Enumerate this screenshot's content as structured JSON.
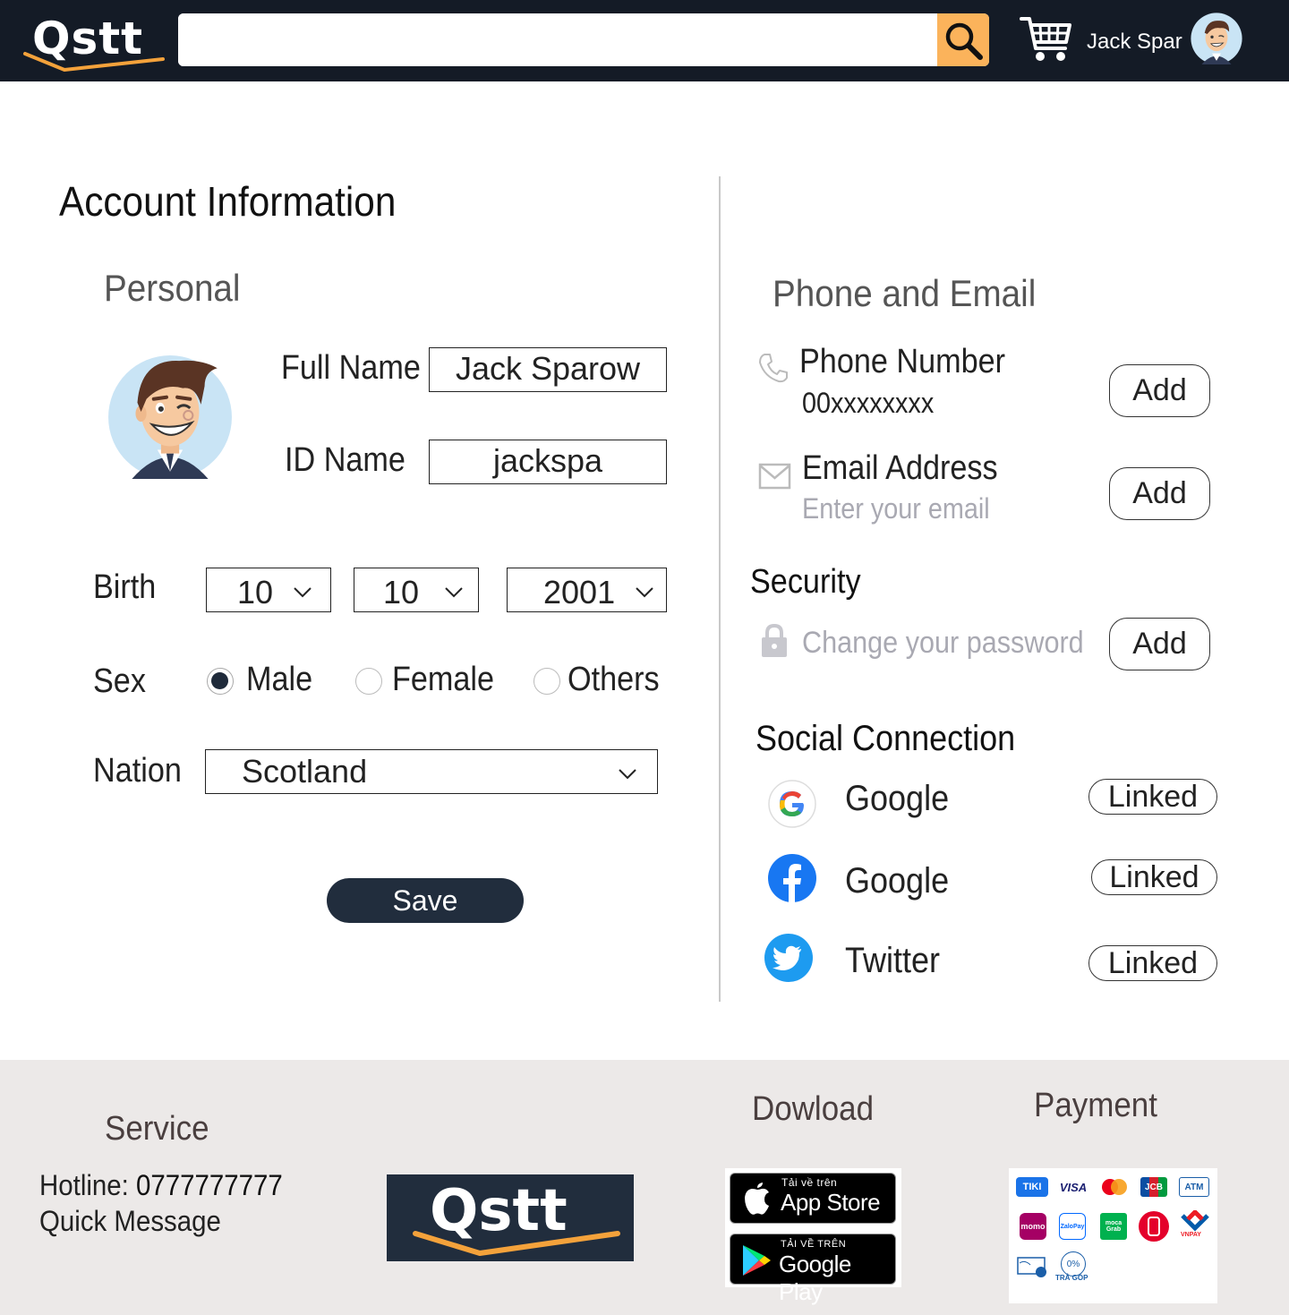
{
  "header": {
    "logo": "Qstt",
    "search_placeholder": "",
    "user_name": "Jack Spar"
  },
  "account": {
    "title": "Account Information",
    "personal_heading": "Personal",
    "full_name_label": "Full Name",
    "full_name_value": "Jack Sparow",
    "id_name_label": "ID Name",
    "id_name_value": "jackspa",
    "birth_label": "Birth",
    "birth_day": "10",
    "birth_month": "10",
    "birth_year": "2001",
    "sex_label": "Sex",
    "sex_options": [
      "Male",
      "Female",
      "Others"
    ],
    "sex_selected": "Male",
    "nation_label": "Nation",
    "nation_value": "Scotland",
    "save_label": "Save"
  },
  "contact": {
    "heading": "Phone and Email",
    "phone_label": "Phone Number",
    "phone_value": "00xxxxxxxx",
    "phone_button": "Add",
    "email_label": "Email Address",
    "email_placeholder": "Enter your email",
    "email_button": "Add",
    "security_heading": "Security",
    "password_text": "Change your password",
    "password_button": "Add"
  },
  "social": {
    "heading": "Social Connection",
    "items": [
      {
        "icon": "google-icon",
        "name": "Google",
        "status": "Linked"
      },
      {
        "icon": "facebook-icon",
        "name": "Google",
        "status": "Linked"
      },
      {
        "icon": "twitter-icon",
        "name": "Twitter",
        "status": "Linked"
      }
    ]
  },
  "footer": {
    "service_heading": "Service",
    "hotline_label": "Hotline: ",
    "hotline_value": "0777777777",
    "quick_message": "Quick Message",
    "logo": "Qstt",
    "download_heading": "Dowload",
    "appstore_small": "Tải về trên",
    "appstore_big": "App Store",
    "googleplay_small": "TẢI VỀ TRÊN",
    "googleplay_big": "Google Play",
    "payment_heading": "Payment",
    "payment_methods": [
      "TIKI",
      "VISA",
      "mastercard",
      "JCB",
      "ATM",
      "momo",
      "ZaloPay",
      "moca Grab",
      "bank",
      "VNPAY",
      "cash",
      "0%"
    ],
    "installment_label": "TRẢ GÓP"
  },
  "colors": {
    "header_bg": "#141b26",
    "search_btn": "#fbb35b",
    "button_dark": "#212d3d",
    "footer_bg": "#ece9e8"
  }
}
